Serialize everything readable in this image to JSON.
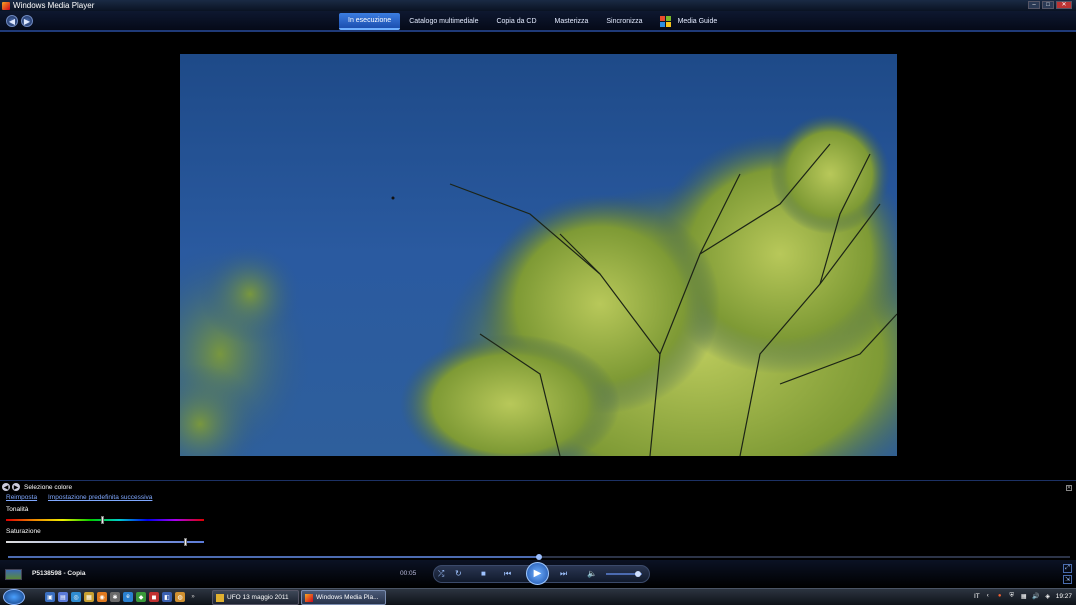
{
  "window": {
    "title": "Windows Media Player"
  },
  "nav": {
    "tabs": [
      {
        "label": "In esecuzione",
        "active": true
      },
      {
        "label": "Catalogo multimediale"
      },
      {
        "label": "Copia da CD"
      },
      {
        "label": "Masterizza"
      },
      {
        "label": "Sincronizza"
      }
    ],
    "guide_label": "Media Guide"
  },
  "enhancements": {
    "title": "Selezione colore",
    "reset_link": "Reimposta",
    "next_preset_link": "Impostazione predefinita successiva",
    "hue_label": "Tonalità",
    "hue_value": 0.49,
    "saturation_label": "Saturazione",
    "saturation_value": 0.91
  },
  "player": {
    "media_title": "P5138598 - Copia",
    "elapsed_time": "00:05",
    "progress": 0.5,
    "volume": 0.9
  },
  "taskbar": {
    "items": [
      {
        "label": "UFO 13 maggio 2011",
        "icon": "folder-icon",
        "active": false
      },
      {
        "label": "Windows Media Pla...",
        "icon": "wmp-icon",
        "active": true
      }
    ],
    "language": "IT",
    "clock": "19:27"
  },
  "colors": {
    "accent": "#3b7de0",
    "nav_border": "#1f3a78",
    "link": "#7fa8ff"
  }
}
